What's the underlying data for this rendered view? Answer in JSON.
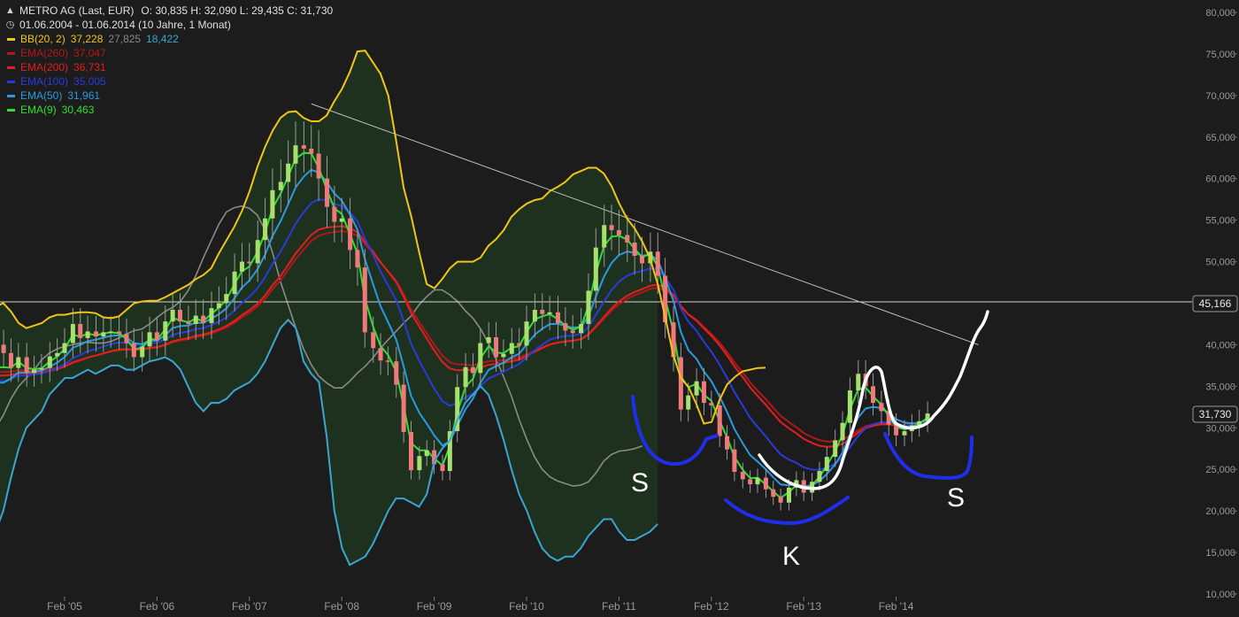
{
  "header": {
    "title": "METRO AG (Last, EUR)",
    "ohlc": "O: 30,835  H: 32,090  L: 29,435  C: 31,730",
    "range": "01.06.2004 - 01.06.2014 (10 Jahre, 1 Monat)"
  },
  "legend": [
    {
      "label": "BB(20, 2)",
      "values": [
        "37,228",
        "27,825",
        "18,422"
      ],
      "colors": [
        "#f0c419",
        "#888888",
        "#3aa6d0"
      ],
      "color": "#f0c419"
    },
    {
      "label": "EMA(260)",
      "values": [
        "37,047"
      ],
      "colors": [
        "#b01818"
      ],
      "color": "#b01818"
    },
    {
      "label": "EMA(200)",
      "values": [
        "36,731"
      ],
      "colors": [
        "#e02020"
      ],
      "color": "#e02020"
    },
    {
      "label": "EMA(100)",
      "values": [
        "35,005"
      ],
      "colors": [
        "#2a3ad8"
      ],
      "color": "#2a3ad8"
    },
    {
      "label": "EMA(50)",
      "values": [
        "31,961"
      ],
      "colors": [
        "#2a9ae0"
      ],
      "color": "#2a9ae0"
    },
    {
      "label": "EMA(9)",
      "values": [
        "30,463"
      ],
      "colors": [
        "#30e030"
      ],
      "color": "#30e030"
    }
  ],
  "price_markers": [
    {
      "value": 45.166,
      "label": "45,166"
    },
    {
      "value": 31.73,
      "label": "31,730"
    }
  ],
  "annotations": [
    "S",
    "S",
    "K"
  ],
  "colors": {
    "up": "#a8e070",
    "down": "#f07a7a",
    "background": "#1c1c1c"
  },
  "chart_data": {
    "type": "candlestick",
    "xlabel": "",
    "ylabel": "",
    "x_ticks": [
      "Feb '05",
      "Feb '06",
      "Feb '07",
      "Feb '08",
      "Feb '09",
      "Feb '10",
      "Feb '11",
      "Feb '12",
      "Feb '13",
      "Feb '14"
    ],
    "y_ticks": [
      {
        "value": 10,
        "label": "10,000"
      },
      {
        "value": 15,
        "label": "15,000"
      },
      {
        "value": 20,
        "label": "20,000"
      },
      {
        "value": 25,
        "label": "25,000"
      },
      {
        "value": 30,
        "label": "30,000"
      },
      {
        "value": 35,
        "label": "35,000"
      },
      {
        "value": 40,
        "label": "40,000"
      },
      {
        "value": 45,
        "label": "45,000"
      },
      {
        "value": 50,
        "label": "50,000"
      },
      {
        "value": 55,
        "label": "55,000"
      },
      {
        "value": 60,
        "label": "60,000"
      },
      {
        "value": 65,
        "label": "65,000"
      },
      {
        "value": 70,
        "label": "70,000"
      },
      {
        "value": 75,
        "label": "75,000"
      },
      {
        "value": 80,
        "label": "80,000"
      }
    ],
    "ylim": [
      8.5,
      81.5
    ],
    "grid": false,
    "series": [
      {
        "name": "METRO AG (Last, EUR)",
        "kind": "candles"
      },
      {
        "name": "BB(20, 2)",
        "kind": "bands"
      },
      {
        "name": "EMA(260)",
        "kind": "line"
      },
      {
        "name": "EMA(200)",
        "kind": "line"
      },
      {
        "name": "EMA(100)",
        "kind": "line"
      },
      {
        "name": "EMA(50)",
        "kind": "line"
      },
      {
        "name": "EMA(9)",
        "kind": "line"
      }
    ],
    "trendline": [
      {
        "date": "2007.75",
        "value": 69
      },
      {
        "date": "2014.97",
        "value": 40
      }
    ],
    "months": [
      "2004.42",
      "2004.50",
      "2004.58",
      "2004.67",
      "2004.75",
      "2004.83",
      "2004.92",
      "2005.00",
      "2005.08",
      "2005.17",
      "2005.25",
      "2005.33",
      "2005.42",
      "2005.50",
      "2005.58",
      "2005.67",
      "2005.75",
      "2005.83",
      "2005.92",
      "2006.00",
      "2006.08",
      "2006.17",
      "2006.25",
      "2006.33",
      "2006.42",
      "2006.50",
      "2006.58",
      "2006.67",
      "2006.75",
      "2006.83",
      "2006.92",
      "2007.00",
      "2007.08",
      "2007.17",
      "2007.25",
      "2007.33",
      "2007.42",
      "2007.50",
      "2007.58",
      "2007.67",
      "2007.75",
      "2007.83",
      "2007.92",
      "2008.00",
      "2008.08",
      "2008.17",
      "2008.25",
      "2008.33",
      "2008.42",
      "2008.50",
      "2008.58",
      "2008.67",
      "2008.75",
      "2008.83",
      "2008.92",
      "2009.00",
      "2009.08",
      "2009.17",
      "2009.25",
      "2009.33",
      "2009.42",
      "2009.50",
      "2009.58",
      "2009.67",
      "2009.75",
      "2009.83",
      "2009.92",
      "2010.00",
      "2010.08",
      "2010.17",
      "2010.25",
      "2010.33",
      "2010.42",
      "2010.50",
      "2010.58",
      "2010.67",
      "2010.75",
      "2010.83",
      "2010.92",
      "2011.00",
      "2011.08",
      "2011.17",
      "2011.25",
      "2011.33",
      "2011.42",
      "2011.50",
      "2011.58",
      "2011.67",
      "2011.75",
      "2011.83",
      "2011.92",
      "2012.00",
      "2012.08",
      "2012.17",
      "2012.25",
      "2012.33",
      "2012.42",
      "2012.50",
      "2012.58",
      "2012.67",
      "2012.75",
      "2012.83",
      "2012.92",
      "2013.00",
      "2013.08",
      "2013.17",
      "2013.25",
      "2013.33",
      "2013.42",
      "2013.50",
      "2013.58",
      "2013.67",
      "2013.75",
      "2013.83",
      "2013.92",
      "2014.00",
      "2014.08",
      "2014.17",
      "2014.25",
      "2014.33",
      "2014.42"
    ],
    "close": [
      39.0,
      37.2,
      38.5,
      36.6,
      37.0,
      37.2,
      38.6,
      39.0,
      40.2,
      42.5,
      40.8,
      41.6,
      41.0,
      41.5,
      41.6,
      41.3,
      40.2,
      38.5,
      39.8,
      41.5,
      40.5,
      42.8,
      44.2,
      42.8,
      42.5,
      43.5,
      42.6,
      44.4,
      45.0,
      46.1,
      48.8,
      50.0,
      49.8,
      52.6,
      55.2,
      58.6,
      59.6,
      61.8,
      64.0,
      63.6,
      63.0,
      60.0,
      56.6,
      54.8,
      55.2,
      51.4,
      49.3,
      41.5,
      39.6,
      38.1,
      38.0,
      35.2,
      29.5,
      24.9,
      26.6,
      27.3,
      25.6,
      24.8,
      29.6,
      34.9,
      37.3,
      36.6,
      40.2,
      40.9,
      38.5,
      38.9,
      40.2,
      39.9,
      42.8,
      44.2,
      43.7,
      43.9,
      42.6,
      41.7,
      41.4,
      42.5,
      46.5,
      51.7,
      54.4,
      53.8,
      53.2,
      52.3,
      50.7,
      49.8,
      51.2,
      48.3,
      42.7,
      38.5,
      32.2,
      33.9,
      35.6,
      33.0,
      32.7,
      29.0,
      27.4,
      24.7,
      23.8,
      23.2,
      24.0,
      22.6,
      21.7,
      21.0,
      22.8,
      23.7,
      22.2,
      23.5,
      24.8,
      26.5,
      28.5,
      30.6,
      34.5,
      36.5,
      35.0,
      33.0,
      32.0,
      30.4,
      29.1,
      29.6,
      30.3,
      30.8,
      31.73
    ],
    "open": [
      40.0,
      39.0,
      37.2,
      38.5,
      36.6,
      37.0,
      37.2,
      38.6,
      39.0,
      40.2,
      42.5,
      40.8,
      41.6,
      41.0,
      41.5,
      41.6,
      41.3,
      40.2,
      38.5,
      39.8,
      41.5,
      40.5,
      42.8,
      44.2,
      42.8,
      42.5,
      43.5,
      42.6,
      44.4,
      45.0,
      46.1,
      48.8,
      50.0,
      49.8,
      52.6,
      55.2,
      58.6,
      59.6,
      61.8,
      64.0,
      63.6,
      63.0,
      60.0,
      56.6,
      54.8,
      55.2,
      51.4,
      49.3,
      41.5,
      39.6,
      38.1,
      38.0,
      35.2,
      29.5,
      24.9,
      26.6,
      27.3,
      25.6,
      24.8,
      29.6,
      34.9,
      37.3,
      36.6,
      40.2,
      40.9,
      38.5,
      38.9,
      40.2,
      39.9,
      42.8,
      44.2,
      43.7,
      43.9,
      42.6,
      41.7,
      41.4,
      42.5,
      46.5,
      51.7,
      54.4,
      53.8,
      53.2,
      52.3,
      50.7,
      49.8,
      51.2,
      48.3,
      42.7,
      38.5,
      32.2,
      33.9,
      35.6,
      33.0,
      32.7,
      29.0,
      27.4,
      24.7,
      23.8,
      23.2,
      24.0,
      22.6,
      21.7,
      21.0,
      22.8,
      23.7,
      22.2,
      23.5,
      24.8,
      26.5,
      28.5,
      30.6,
      34.5,
      36.5,
      35.0,
      33.0,
      32.0,
      30.4,
      29.1,
      29.6,
      30.3,
      30.835
    ],
    "bb_upper": [
      43.0,
      44.6,
      45.0,
      44.0,
      42.6,
      42.0,
      42.3,
      42.6,
      43.3,
      43.6,
      43.6,
      43.8,
      43.9,
      43.9,
      43.8,
      43.3,
      43.2,
      43.4,
      44.2,
      45.0,
      45.2,
      45.3,
      45.3,
      45.7,
      46.2,
      46.7,
      47.2,
      47.9,
      48.4,
      49.2,
      51.0,
      52.6,
      54.2,
      56.1,
      58.5,
      61.4,
      63.8,
      65.8,
      67.3,
      68.0,
      68.1,
      67.3,
      66.9,
      66.9,
      67.6,
      69.3,
      70.8,
      72.8,
      75.3,
      75.4,
      74.0,
      72.6,
      70.0,
      64.7,
      58.9,
      55.4,
      51.2,
      47.3,
      46.8,
      47.9,
      49.2,
      50.0,
      50.0,
      50.0,
      50.5,
      51.9,
      52.7,
      53.8,
      55.4,
      56.3,
      57.0,
      57.4,
      57.6,
      58.5,
      59.0,
      59.6,
      60.5,
      60.9,
      61.3,
      61.3,
      60.6,
      59.1,
      57.0,
      55.2,
      54.0,
      52.4,
      50.4,
      47.3,
      43.2,
      38.8,
      36.0,
      34.9,
      32.9,
      30.5,
      30.7,
      33.3,
      35.2,
      36.1,
      36.8,
      37.0,
      37.2,
      37.228
    ],
    "bb_lower": [
      16.5,
      17.5,
      20.0,
      24.0,
      27.5,
      30.0,
      31.0,
      32.0,
      34.0,
      35.0,
      36.0,
      36.0,
      36.5,
      37.0,
      36.5,
      37.0,
      37.5,
      37.5,
      37.0,
      37.0,
      37.5,
      38.0,
      38.2,
      38.5,
      38.0,
      37.0,
      35.0,
      33.0,
      32.0,
      33.0,
      33.0,
      33.5,
      34.5,
      35.0,
      35.5,
      36.5,
      38.0,
      40.0,
      42.0,
      43.0,
      42.0,
      38.0,
      36.5,
      35.5,
      29.0,
      20.0,
      15.5,
      13.5,
      14.0,
      14.5,
      16.0,
      18.0,
      20.0,
      21.5,
      21.5,
      21.0,
      20.5,
      22.0,
      26.0,
      27.5,
      28.5,
      31.0,
      33.0,
      34.0,
      35.0,
      34.0,
      31.5,
      28.5,
      25.0,
      22.0,
      20.0,
      17.5,
      15.5,
      14.5,
      14.0,
      14.5,
      14.5,
      15.5,
      17.0,
      18.0,
      19.0,
      19.0,
      17.5,
      16.5,
      16.5,
      17.0,
      17.5,
      18.422
    ],
    "bb_mid": [
      29.0,
      30.0,
      31.5,
      33.5,
      35.0,
      36.0,
      37.0,
      38.2,
      39.0,
      39.5,
      39.8,
      40.0,
      40.2,
      40.3,
      40.2,
      40.2,
      40.4,
      40.8,
      41.3,
      41.7,
      41.9,
      42.5,
      43.3,
      44.0,
      44.5,
      45.2,
      46.5,
      48.3,
      50.5,
      52.5,
      54.5,
      56.0,
      56.5,
      56.7,
      56.4,
      55.6,
      53.8,
      51.0,
      47.6,
      44.8,
      42.0,
      39.5,
      37.6,
      36.2,
      35.4,
      34.8,
      34.8,
      35.6,
      36.6,
      37.4,
      38.4,
      39.6,
      40.6,
      41.6,
      42.6,
      43.5,
      44.8,
      45.8,
      46.6,
      46.6,
      46.0,
      45.2,
      44.1,
      43.2,
      41.9,
      40.2,
      38.3,
      36.1,
      33.8,
      31.0,
      28.6,
      26.5,
      25.0,
      24.1,
      23.6,
      23.3,
      23.0,
      23.1,
      23.5,
      24.6,
      26.0,
      26.8,
      27.2,
      27.3,
      27.5,
      27.825
    ]
  }
}
